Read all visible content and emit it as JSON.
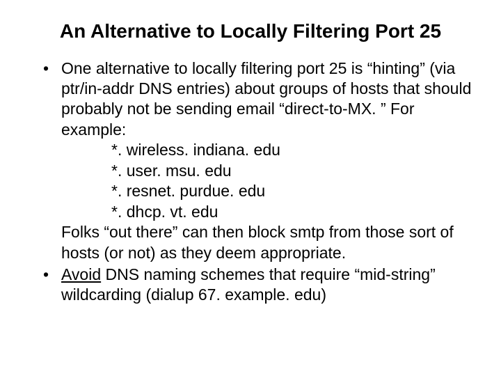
{
  "title": "An Alternative to Locally Filtering Port 25",
  "bullets": [
    {
      "lead": "One alternative to locally filtering port 25 is “hinting” (via ptr/in-addr DNS entries) about groups of hosts that should probably not be sending email “direct-to-MX. ” For example:",
      "examples": [
        "*. wireless. indiana. edu",
        "*. user. msu. edu",
        "*. resnet. purdue. edu",
        "*. dhcp. vt. edu"
      ],
      "trail": "Folks “out there” can then block smtp from those sort of hosts (or not) as they deem appropriate."
    },
    {
      "underlined": "Avoid",
      "rest": " DNS naming schemes that require “mid-string” wildcarding (dialup 67. example. edu)"
    }
  ]
}
